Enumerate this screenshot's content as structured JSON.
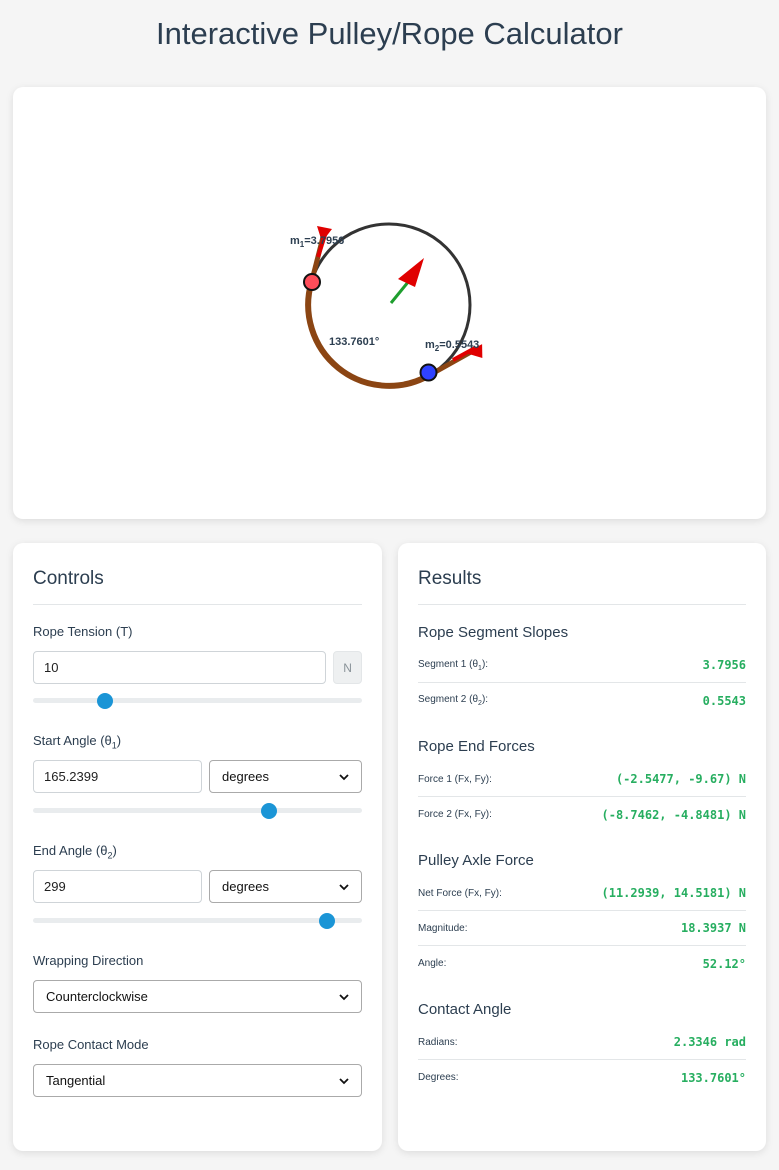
{
  "page": {
    "title": "Interactive Pulley/Rope Calculator"
  },
  "diagram": {
    "m1_prefix": "m",
    "m1_sub": "1",
    "m1_value": "=3.7956",
    "m2_prefix": "m",
    "m2_sub": "2",
    "m2_value": "=0.5543",
    "angle_label": "133.7601°",
    "colors": {
      "pulley": "#333333",
      "rope": "#8b4513",
      "start_point": "#ff4d5a",
      "end_point": "#2f42ff",
      "force_arrow": "#e00000",
      "axle_vector": "#1e9e2e"
    }
  },
  "controls": {
    "title": "Controls",
    "tension": {
      "label": "Rope Tension (T)",
      "value": "10",
      "unit": "N",
      "slider_fraction": 0.22
    },
    "start_angle": {
      "label_main": "Start Angle (θ",
      "label_sub": "1",
      "label_end": ")",
      "value": "165.2399",
      "unit": "degrees",
      "slider_fraction": 0.716
    },
    "end_angle": {
      "label_main": "End Angle (θ",
      "label_sub": "2",
      "label_end": ")",
      "value": "299",
      "unit": "degrees",
      "slider_fraction": 0.893
    },
    "direction": {
      "label": "Wrapping Direction",
      "value": "Counterclockwise"
    },
    "contact_mode": {
      "label": "Rope Contact Mode",
      "value": "Tangential"
    }
  },
  "results": {
    "title": "Results",
    "slopes": {
      "title": "Rope Segment Slopes",
      "seg1_label": "Segment 1 (θ",
      "seg1_sub": "1",
      "seg1_end": "):",
      "seg1_value": "3.7956",
      "seg2_label": "Segment 2 (θ",
      "seg2_sub": "2",
      "seg2_end": "):",
      "seg2_value": "0.5543"
    },
    "end_forces": {
      "title": "Rope End Forces",
      "f1_label": "Force 1 (Fx, Fy):",
      "f1_value": "(-2.5477, -9.67) N",
      "f2_label": "Force 2 (Fx, Fy):",
      "f2_value": "(-8.7462, -4.8481) N"
    },
    "axle": {
      "title": "Pulley Axle Force",
      "net_label": "Net Force (Fx, Fy):",
      "net_value": "(11.2939, 14.5181) N",
      "mag_label": "Magnitude:",
      "mag_value": "18.3937 N",
      "angle_label": "Angle:",
      "angle_value": "52.12°"
    },
    "contact": {
      "title": "Contact Angle",
      "rad_label": "Radians:",
      "rad_value": "2.3346 rad",
      "deg_label": "Degrees:",
      "deg_value": "133.7601°"
    }
  }
}
